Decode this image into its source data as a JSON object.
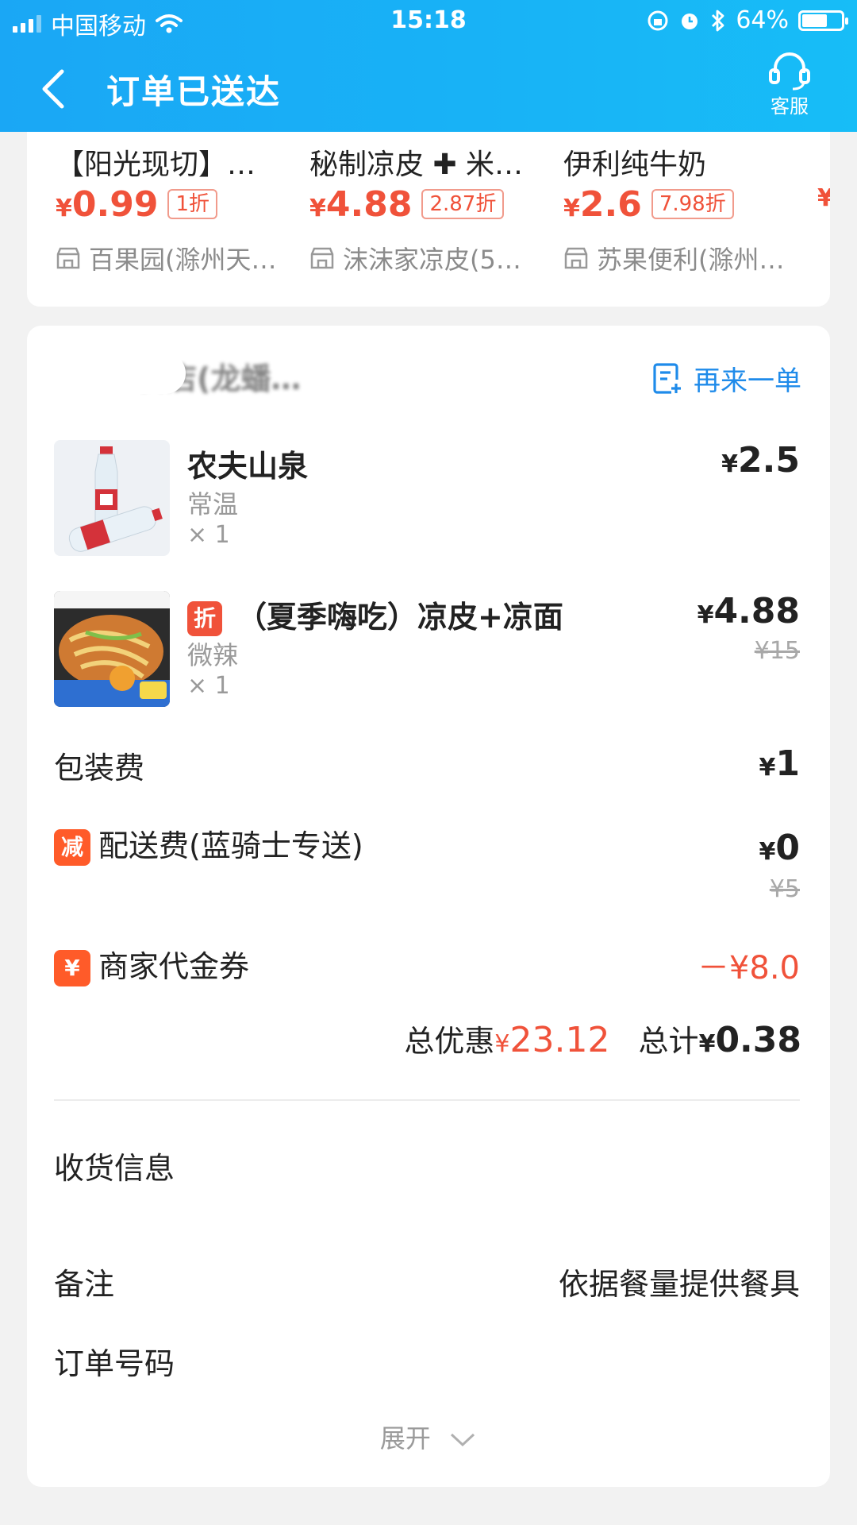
{
  "status_bar": {
    "carrier": "中国移动",
    "time": "15:18",
    "battery": "64%",
    "battery_level": 0.64
  },
  "header": {
    "title": "订单已送达",
    "service_label": "客服"
  },
  "recommendations": [
    {
      "name": "【阳光现切】…",
      "price_symbol": "¥",
      "price": "0.99",
      "discount": "1折",
      "shop": "百果园(滁州天…"
    },
    {
      "name": "秘制凉皮 ✚ 米…",
      "price_symbol": "¥",
      "price": "4.88",
      "discount": "2.87折",
      "shop": "沫沫家凉皮(5…"
    },
    {
      "name": "伊利纯牛奶",
      "price_symbol": "¥",
      "price": "2.6",
      "discount": "7.98折",
      "shop": "苏果便利(滁州…"
    }
  ],
  "order": {
    "shop_name": "…食店(龙蟠…",
    "reorder_label": "再来一单",
    "items": [
      {
        "name": "农夫山泉",
        "spec": "常温",
        "qty": "× 1",
        "price_symbol": "¥",
        "price": "2.5"
      },
      {
        "tag": "折",
        "name": "（夏季嗨吃）凉皮+凉面",
        "spec": "微辣",
        "qty": "× 1",
        "price_symbol": "¥",
        "price": "4.88",
        "original_price": "¥15"
      }
    ],
    "packaging": {
      "label": "包装费",
      "price_symbol": "¥",
      "value": "1"
    },
    "delivery": {
      "badge": "减",
      "label": "配送费(蓝骑士专送)",
      "price_symbol": "¥",
      "value": "0",
      "original": "¥5"
    },
    "voucher": {
      "badge": "¥",
      "label": "商家代金券",
      "value": "－¥8.0"
    },
    "totals": {
      "discount_label": "总优惠",
      "discount_symbol": "¥",
      "discount_value": "23.12",
      "total_label": "总计",
      "total_symbol": "¥",
      "total_value": "0.38"
    },
    "info": {
      "address_label": "收货信息",
      "remark_label": "备注",
      "remark_value": "依据餐量提供餐具",
      "order_no_label": "订单号码",
      "expand_label": "展开"
    }
  },
  "colors": {
    "header_blue": "#1aa7f5",
    "price_red": "#f0523a",
    "link_blue": "#1f8bea",
    "badge_orange": "#ff5b29"
  }
}
